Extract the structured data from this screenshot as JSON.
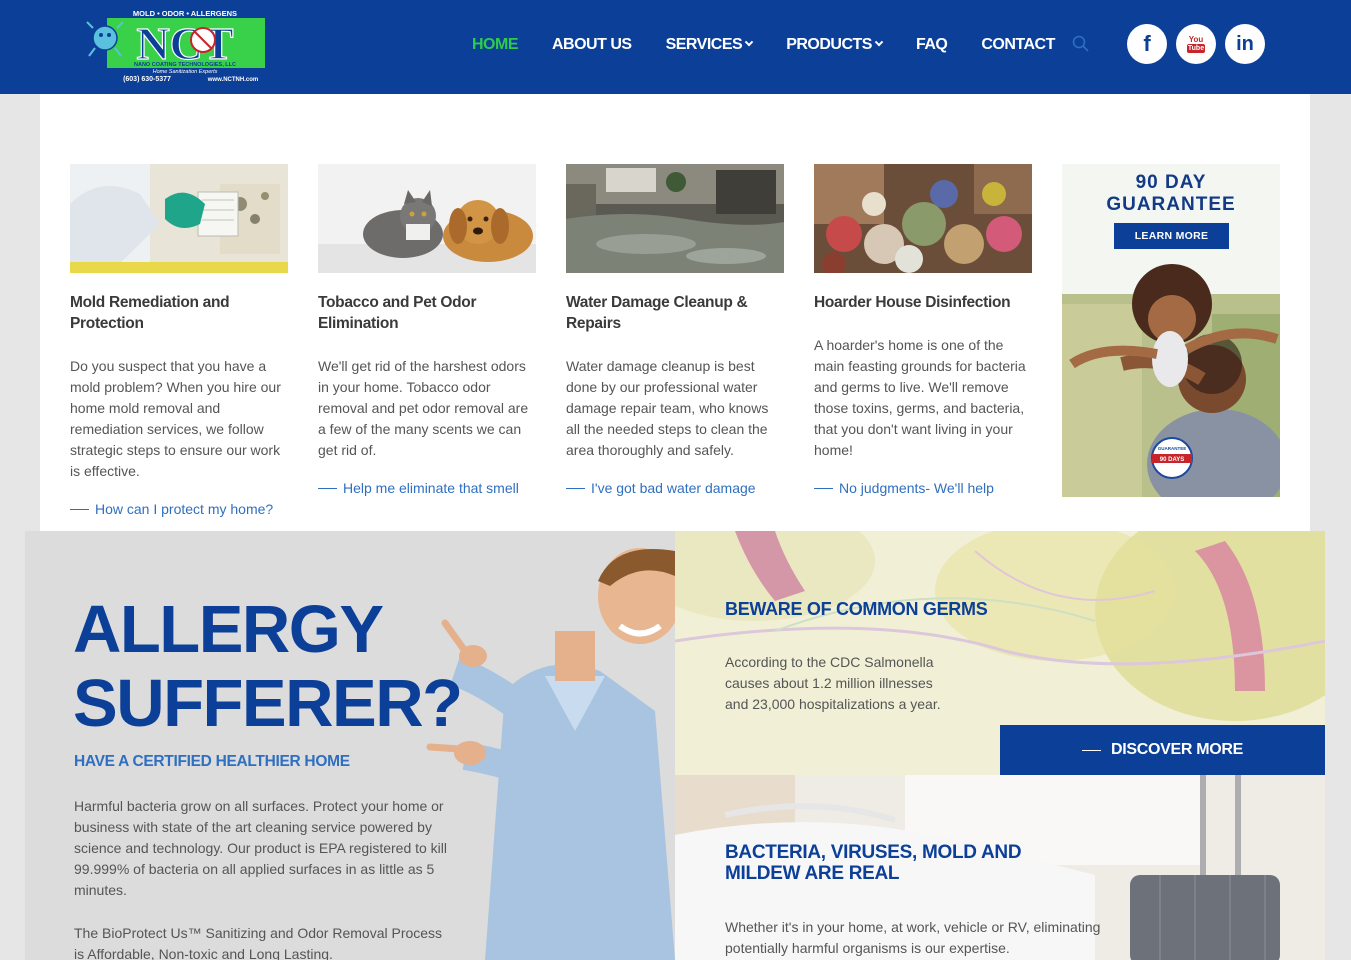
{
  "header": {
    "logo": {
      "top_text": "MOLD • ODOR • ALLERGENS",
      "brand": "NCT",
      "company": "NANO COATING TECHNOLOGIES, LLC",
      "tagline": "Home Sanitization Experts",
      "phone": "(603) 630-5377",
      "website": "www.NCTNH.com"
    },
    "nav": [
      {
        "label": "HOME",
        "active": true,
        "dropdown": false
      },
      {
        "label": "ABOUT US",
        "active": false,
        "dropdown": false
      },
      {
        "label": "SERVICES",
        "active": false,
        "dropdown": true
      },
      {
        "label": "PRODUCTS",
        "active": false,
        "dropdown": true
      },
      {
        "label": "FAQ",
        "active": false,
        "dropdown": false
      },
      {
        "label": "CONTACT",
        "active": false,
        "dropdown": false
      }
    ],
    "social": {
      "facebook": "f",
      "youtube_top": "You",
      "youtube_bottom": "Tube",
      "linkedin": "in"
    }
  },
  "services": [
    {
      "title": "Mold Remediation and Protection",
      "text": "Do you suspect that you have a mold problem? When you hire our home mold removal and remediation services, we follow strategic steps to ensure our work is effective.",
      "link": "How can I protect my home?"
    },
    {
      "title": "Tobacco and Pet Odor Elimination",
      "text": "We'll get rid of the harshest odors in your home. Tobacco odor removal and pet odor removal are a few of the many scents we can get rid of.",
      "link": "Help me eliminate that smell"
    },
    {
      "title": "Water Damage Cleanup & Repairs",
      "text": "Water damage cleanup is best done by our professional water damage repair team, who knows all the needed steps to clean the area thoroughly and safely.",
      "link": "I've got bad water damage"
    },
    {
      "title": "Hoarder House Disinfection",
      "text": "A hoarder's home is one of the main feasting grounds for bacteria and germs to live. We'll remove those toxins, germs, and bacteria, that you don't want living in your home!",
      "link": "No judgments- We'll help"
    }
  ],
  "promo": {
    "line1": "90 DAY",
    "line2": "GUARANTEE",
    "button": "LEARN MORE",
    "badge_top": "GUARANTEE",
    "badge_mid": "90 DAYS"
  },
  "allergy": {
    "heading_line1": "ALLERGY",
    "heading_line2": "SUFFERER?",
    "subheading": "HAVE A CERTIFIED HEALTHIER HOME",
    "paragraph1": "Harmful bacteria grow on all surfaces. Protect your home or business with state of the art cleaning service powered by science and technology. Our product is EPA registered to kill 99.999% of bacteria on all applied surfaces in as little as 5 minutes.",
    "paragraph2": "The BioProtect Us™ Sanitizing and Odor Removal Process is Affordable, Non-toxic and Long Lasting."
  },
  "germs": {
    "title": "BEWARE OF COMMON GERMS",
    "text": "According to the CDC Salmonella causes about 1.2 million illnesses and 23,000 hospitalizations a year.",
    "button": "DISCOVER MORE"
  },
  "bacteria": {
    "title": "BACTERIA, VIRUSES, MOLD AND MILDEW ARE REAL",
    "text": "Whether it's in your home, at work, vehicle or RV, eliminating potentially harmful organisms is our expertise."
  },
  "colors": {
    "brand_blue": "#0b3f98",
    "active_green": "#2fcc4a",
    "link_blue": "#2f6fc0"
  }
}
